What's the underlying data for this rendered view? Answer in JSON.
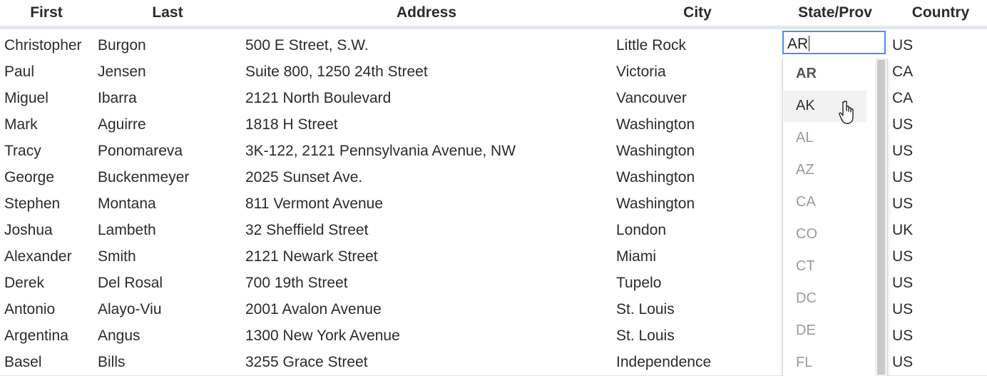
{
  "table": {
    "columns": [
      "First",
      "Last",
      "Address",
      "City",
      "State/Prov",
      "Country"
    ],
    "rows": [
      {
        "first": "Christopher",
        "last": "Burgon",
        "address": "500 E Street, S.W.",
        "city": "Little Rock",
        "state": "AR",
        "country": "US"
      },
      {
        "first": "Paul",
        "last": "Jensen",
        "address": "Suite 800, 1250 24th Street",
        "city": "Victoria",
        "state": "",
        "country": "CA"
      },
      {
        "first": "Miguel",
        "last": "Ibarra",
        "address": "2121 North Boulevard",
        "city": "Vancouver",
        "state": "",
        "country": "CA"
      },
      {
        "first": "Mark",
        "last": "Aguirre",
        "address": "1818 H Street",
        "city": "Washington",
        "state": "",
        "country": "US"
      },
      {
        "first": "Tracy",
        "last": "Ponomareva",
        "address": "3K-122, 2121 Pennsylvania Avenue, NW",
        "city": "Washington",
        "state": "",
        "country": "US"
      },
      {
        "first": "George",
        "last": "Buckenmeyer",
        "address": "2025 Sunset Ave.",
        "city": "Washington",
        "state": "",
        "country": "US"
      },
      {
        "first": "Stephen",
        "last": "Montana",
        "address": "811 Vermont Avenue",
        "city": "Washington",
        "state": "",
        "country": "US"
      },
      {
        "first": "Joshua",
        "last": "Lambeth",
        "address": "32 Sheffield Street",
        "city": "London",
        "state": "",
        "country": "UK"
      },
      {
        "first": "Alexander",
        "last": "Smith",
        "address": "2121 Newark Street",
        "city": "Miami",
        "state": "",
        "country": "US"
      },
      {
        "first": "Derek",
        "last": "Del Rosal",
        "address": "700 19th Street",
        "city": "Tupelo",
        "state": "",
        "country": "US"
      },
      {
        "first": "Antonio",
        "last": "Alayo-Viu",
        "address": "2001 Avalon Avenue",
        "city": "St. Louis",
        "state": "",
        "country": "US"
      },
      {
        "first": "Argentina",
        "last": "Angus",
        "address": "1300 New York Avenue",
        "city": "St. Louis",
        "state": "",
        "country": "US"
      },
      {
        "first": "Basel",
        "last": "Bills",
        "address": "3255 Grace Street",
        "city": "Independence",
        "state": "",
        "country": "US"
      }
    ]
  },
  "editor": {
    "value": "AR",
    "options": [
      "AR",
      "AK",
      "AL",
      "AZ",
      "CA",
      "CO",
      "CT",
      "DC",
      "DE",
      "FL"
    ],
    "selected": "AR",
    "hovered": "AK",
    "focus_color": "#4a8df0"
  },
  "icons": {
    "cursor": "hand-pointer-icon"
  }
}
